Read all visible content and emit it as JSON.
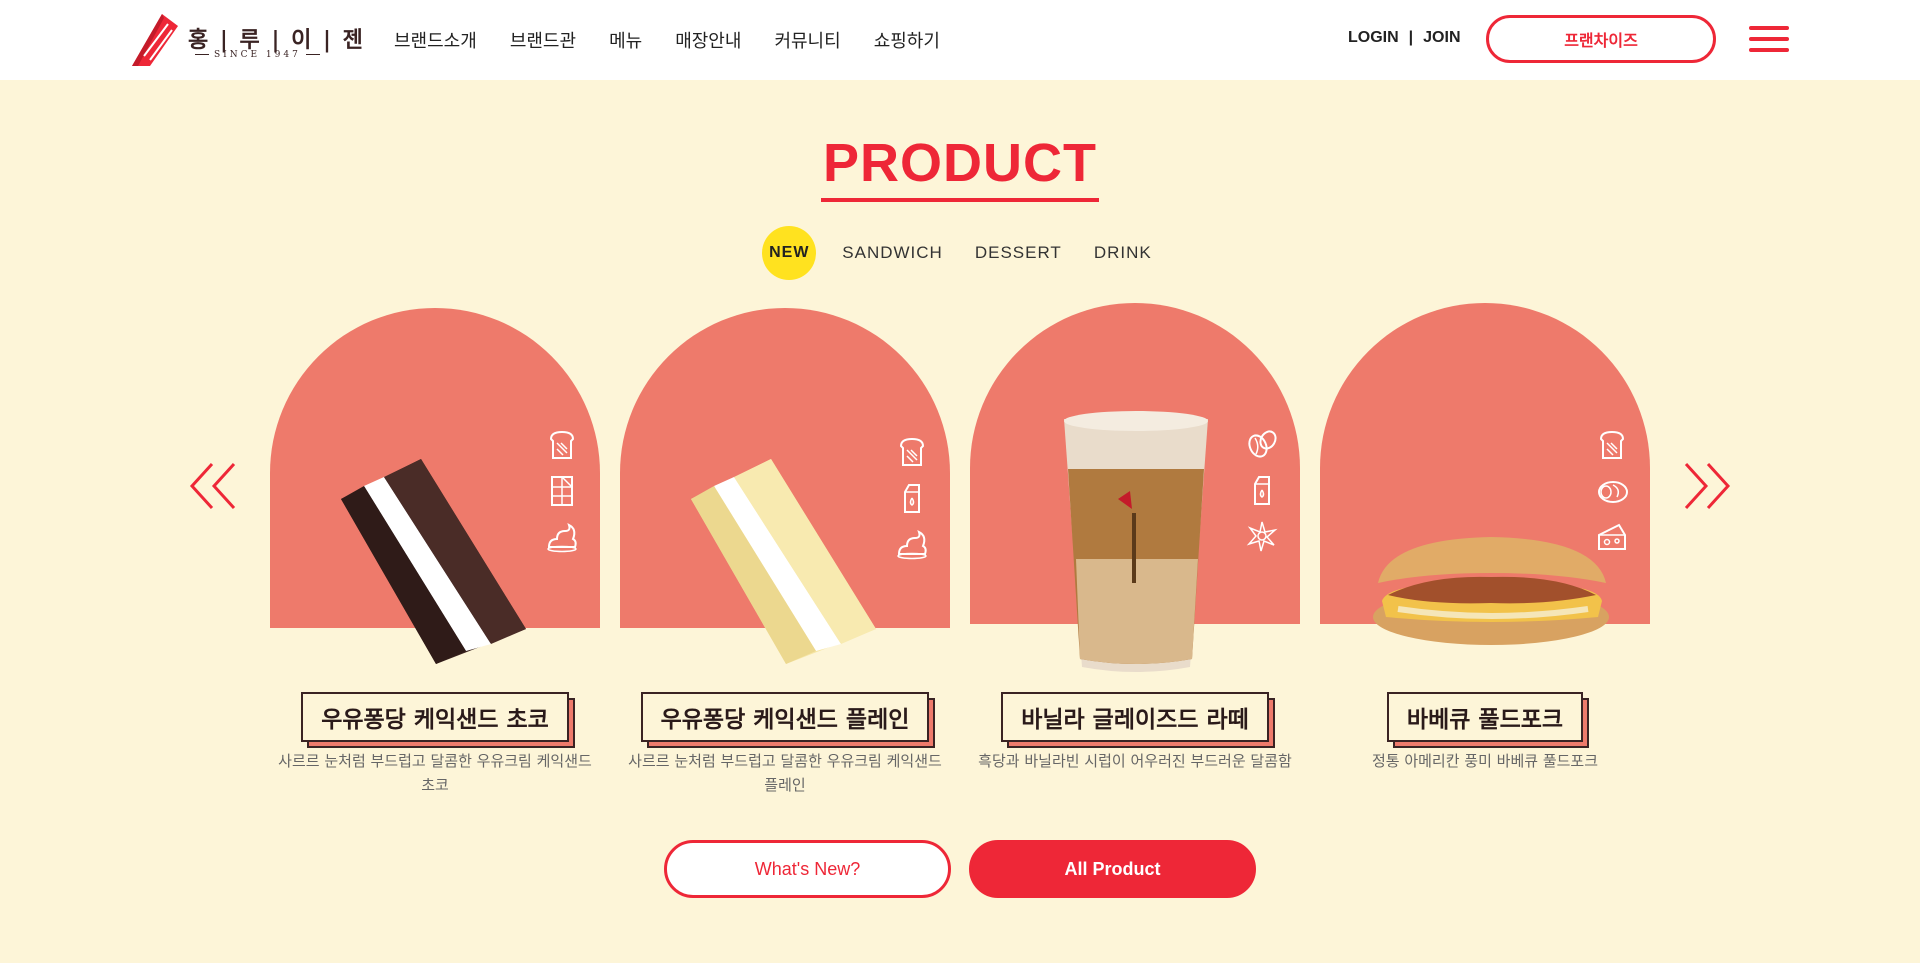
{
  "header": {
    "logo_name": "홍 | 루 | 이 | 젠",
    "logo_since": "SINCE 1947",
    "nav": [
      "브랜드소개",
      "브랜드관",
      "메뉴",
      "매장안내",
      "커뮤니티",
      "쇼핑하기"
    ],
    "login": "LOGIN",
    "separator": "|",
    "join": "JOIN",
    "franchise": "프랜차이즈",
    "menu_icon": "hamburger-icon"
  },
  "product": {
    "title": "PRODUCT",
    "tabs": [
      "NEW",
      "SANDWICH",
      "DESSERT",
      "DRINK"
    ],
    "active_tab": "NEW",
    "items": [
      {
        "name": "우유퐁당 케익샌드 초코",
        "desc": "사르르 눈처럼 부드럽고 달콤한 우유크림 케익샌드 초코",
        "icons": [
          "bread-icon",
          "chocolate-bar-icon",
          "cream-icon"
        ]
      },
      {
        "name": "우유퐁당 케익샌드 플레인",
        "desc": "사르르 눈처럼 부드럽고 달콤한 우유크림 케익샌드 플레인",
        "icons": [
          "bread-icon",
          "milk-carton-icon",
          "cream-icon"
        ]
      },
      {
        "name": "바닐라 글레이즈드 라떼",
        "desc": "흑당과 바닐라빈 시럽이 어우러진 부드러운 달콤함",
        "icons": [
          "coffee-bean-icon",
          "milk-carton-icon",
          "vanilla-flower-icon"
        ]
      },
      {
        "name": "바베큐 풀드포크",
        "desc": "정통 아메리칸 풍미 바베큐 풀드포크",
        "icons": [
          "bread-icon",
          "meat-icon",
          "cheese-icon"
        ]
      }
    ],
    "prev_icon": "double-chevron-left-icon",
    "next_icon": "double-chevron-right-icon",
    "whats_new": "What's New?",
    "all_product": "All Product"
  },
  "colors": {
    "brand_red": "#ee2737",
    "arch_coral": "#ee7a6b",
    "section_bg": "#fdf5d8",
    "active_tab": "#ffe21f"
  }
}
